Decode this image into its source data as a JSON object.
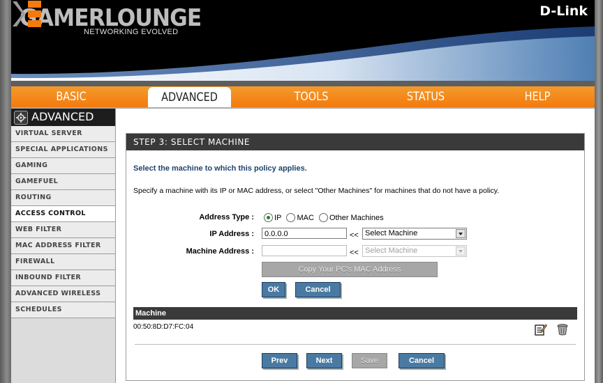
{
  "banner": {
    "logo_text": "GAMERLOUNGE",
    "logo_tagline": "NETWORKING EVOLVED",
    "brand": "D-Link"
  },
  "nav": {
    "tabs": [
      {
        "label": "BASIC",
        "active": false
      },
      {
        "label": "ADVANCED",
        "active": true
      },
      {
        "label": "TOOLS",
        "active": false
      },
      {
        "label": "STATUS",
        "active": false
      },
      {
        "label": "HELP",
        "active": false
      }
    ]
  },
  "sidebar": {
    "title": "ADVANCED",
    "items": [
      {
        "label": "VIRTUAL SERVER"
      },
      {
        "label": "SPECIAL APPLICATIONS"
      },
      {
        "label": "GAMING"
      },
      {
        "label": "GAMEFUEL"
      },
      {
        "label": "ROUTING"
      },
      {
        "label": "ACCESS CONTROL",
        "active": true
      },
      {
        "label": "WEB FILTER"
      },
      {
        "label": "MAC ADDRESS FILTER"
      },
      {
        "label": "FIREWALL"
      },
      {
        "label": "INBOUND FILTER"
      },
      {
        "label": "ADVANCED WIRELESS"
      },
      {
        "label": "SCHEDULES"
      }
    ]
  },
  "main": {
    "title": "STEP 3: SELECT MACHINE",
    "intro": "Select the machine to which this policy applies.",
    "description": "Specify a machine with its IP or MAC address, or select \"Other Machines\" for machines that do not have a policy.",
    "form": {
      "address_type_label": "Address Type :",
      "address_type_options": [
        "IP",
        "MAC",
        "Other Machines"
      ],
      "address_type_selected": "IP",
      "ip_label": "IP Address :",
      "ip_value": "0.0.0.0",
      "ip_arrow": "<<",
      "ip_select": "Select Machine",
      "mac_label": "Machine Address :",
      "mac_value": "",
      "mac_arrow": "<<",
      "mac_select": "Select Machine",
      "copy_mac_button": "Copy Your PC's MAC Address",
      "ok_button": "OK",
      "cancel_button": "Cancel"
    },
    "machine_table": {
      "header": "Machine",
      "rows": [
        "00:50:8D:D7:FC:04"
      ]
    },
    "footer_buttons": {
      "prev": "Prev",
      "next": "Next",
      "save": "Save",
      "cancel": "Cancel"
    }
  },
  "colors": {
    "nav_orange": "#f47a0c",
    "header_dark": "#3a3a3a",
    "button_blue": "#4a7aa2",
    "intro_blue": "#20446e"
  }
}
